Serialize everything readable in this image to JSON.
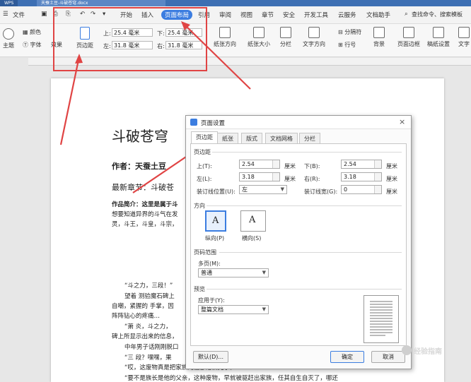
{
  "titlebar": {
    "tab1": "WPS",
    "tab2": "天蚕土豆-斗破苍穹.docx"
  },
  "menubar": {
    "file_menu": "文件",
    "items": [
      "开始",
      "插入",
      "页面布局",
      "引用",
      "审阅",
      "视图",
      "章节",
      "安全",
      "开发工具",
      "云服务",
      "文档助手"
    ],
    "search_placeholder": "查找命令、搜索模板"
  },
  "ribbon": {
    "theme": "主题",
    "colors": "颜色",
    "fonts": "字体",
    "effects": "效果",
    "margins": "页边距",
    "top_label": "上:",
    "top_value": "25.4 毫米",
    "bottom_label": "下:",
    "bottom_value": "25.4 毫米",
    "left_label": "左:",
    "left_value": "31.8 毫米",
    "right_label": "右:",
    "right_value": "31.8 毫米",
    "orientation": "纸张方向",
    "size": "纸张大小",
    "columns": "分栏",
    "text_direction": "文字方向",
    "line_numbers": "行号",
    "breaks": "分隔符",
    "background": "背景",
    "page_border": "页面边框",
    "manuscript": "稿纸设置",
    "wrap": "文字"
  },
  "document": {
    "title": "斗破苍穹",
    "author": "作者：天蚕土豆",
    "latest": "最新章节：斗破苍",
    "intro1": "作品简介：这里是属于斗",
    "intro2": "想要知道异界的斗气在发",
    "intro3": "灵，斗王，斗皇，斗宗，",
    "p1": "“斗之力，三段！”",
    "p2": "望着 测验魔石碑上",
    "p3": "自嘲，紧握的 手掌，因",
    "p4": "阵阵钻心的疼痛…",
    "p5": "“萧 炎，斗之力，",
    "p6": "碑上所显示出来的信息，",
    "p7": "中年男子话刚刚脱口",
    "p8": "“三 段？嘿嘿，果",
    "p9": "“哎，这废物真是把家族的脸都给丢光了。",
    "p10": "“要不是族长是他的父亲，这种废物，早就被驱赶出家族，任其自生自灭了，哪还"
  },
  "dialog": {
    "title": "页面设置",
    "tabs": [
      "页边距",
      "纸张",
      "版式",
      "文档网格",
      "分栏"
    ],
    "margins_section": "页边距",
    "top_label": "上(T):",
    "top_value": "2.54",
    "bottom_label": "下(B):",
    "bottom_value": "2.54",
    "left_label": "左(L):",
    "left_value": "3.18",
    "right_label": "右(R):",
    "right_value": "3.18",
    "unit": "厘米",
    "gutter_pos_label": "装订线位置(U):",
    "gutter_pos_value": "左",
    "gutter_width_label": "装订线宽(G):",
    "gutter_width_value": "0",
    "orientation_section": "方向",
    "portrait": "纵向(P)",
    "landscape": "横向(S)",
    "pages_section": "页码范围",
    "multiple_pages_label": "多页(M):",
    "multiple_pages_value": "普通",
    "preview_section": "预览",
    "apply_to_label": "应用于(Y):",
    "apply_to_value": "整篇文档",
    "default_button": "默认(D)...",
    "ok_button": "确定",
    "cancel_button": "取消"
  },
  "watermark": "经验指南",
  "colors": {
    "accent": "#3c7de0",
    "highlight": "#e04444",
    "titlebar": "#3d6fb3"
  }
}
